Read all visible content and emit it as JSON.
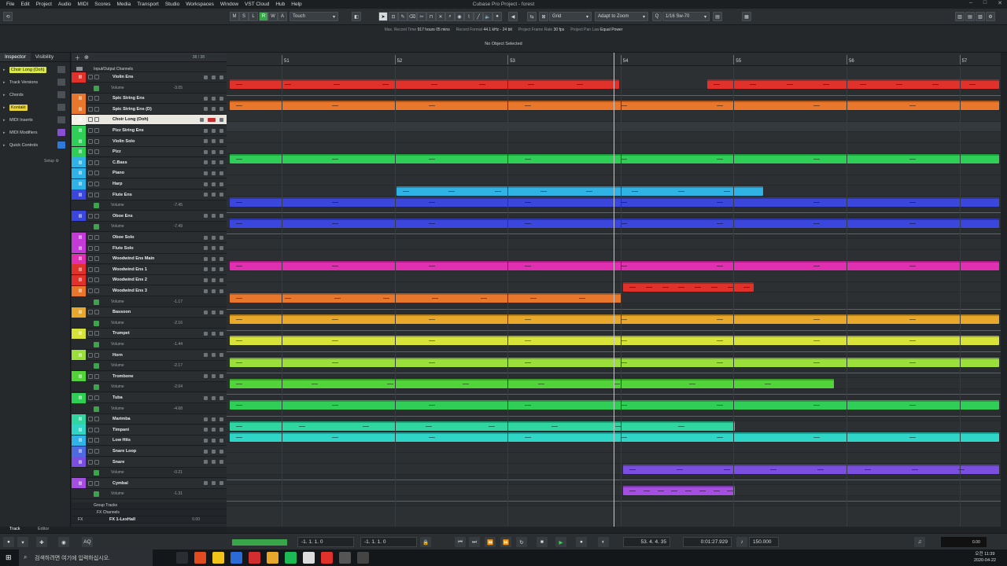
{
  "window": {
    "title": "Cubase Pro Project - forest",
    "menu": [
      "File",
      "Edit",
      "Project",
      "Audio",
      "MIDI",
      "Scores",
      "Media",
      "Transport",
      "Studio",
      "Workspaces",
      "Window",
      "VST Cloud",
      "Hub",
      "Help"
    ]
  },
  "toolbar": {
    "msra": [
      "M",
      "S",
      "L",
      "R",
      "W",
      "A"
    ],
    "automation_mode": "Touch",
    "snap_type": "Grid",
    "grid_label": "Adapt to Zoom",
    "quantize": "1/16 Sw-70"
  },
  "infoline": [
    {
      "label": "Max. Record Time",
      "value": "917 hours 05 mins"
    },
    {
      "label": "Record Format",
      "value": "44.1 kHz - 24 bit"
    },
    {
      "label": "Project Frame Rate",
      "value": "30 fps"
    },
    {
      "label": "Project Pan Law",
      "value": "Equal Power"
    }
  ],
  "eventline": "No Object Selected",
  "inspector": {
    "tabs": [
      "Inspector",
      "Visibility"
    ],
    "sections": [
      {
        "label": "Choir Long (Ooh)",
        "style": "pill"
      },
      {
        "label": "Track Versions"
      },
      {
        "label": "Chords"
      },
      {
        "label": "Kontakt",
        "style": "pill-orange"
      },
      {
        "label": "MIDI Inserts"
      },
      {
        "label": "MIDI Modifiers"
      },
      {
        "label": "Quick Controls"
      }
    ],
    "setup": "Setup"
  },
  "tracklist": {
    "count": "38 / 38",
    "folder": "Input/Output Channels",
    "group_tracks": "Group Tracks",
    "fx_channels": "FX Channels",
    "fx1": "FX 1-LexHall",
    "fx1_val": "0.00"
  },
  "tracks": [
    {
      "name": "Violin Ens",
      "color": "#e0312a",
      "auto": "-3.05"
    },
    {
      "name": "Spic String Ens",
      "color": "#e8772b"
    },
    {
      "name": "Spic String Ens (D)",
      "color": "#e8772b"
    },
    {
      "name": "Choir Long (Ooh)",
      "color": "#f3f1e8",
      "selected": true
    },
    {
      "name": "Pizz String Ens",
      "color": "#2fcf57"
    },
    {
      "name": "Violin Solo",
      "color": "#2fcf57"
    },
    {
      "name": "Pizz",
      "color": "#2fcf57"
    },
    {
      "name": "C.Bass",
      "color": "#2fb3e6"
    },
    {
      "name": "Piano",
      "color": "#2fb3e6"
    },
    {
      "name": "Harp",
      "color": "#2fb3e6"
    },
    {
      "name": "Flute Ens",
      "color": "#3b47dc",
      "auto": "-7.45"
    },
    {
      "name": "Oboe Ens",
      "color": "#3b47dc",
      "auto": "-7.49"
    },
    {
      "name": "Oboe Solo",
      "color": "#c43ad6"
    },
    {
      "name": "Flute Solo",
      "color": "#c43ad6"
    },
    {
      "name": "Woodwind Ens Main",
      "color": "#e02fb0"
    },
    {
      "name": "Woodwind Ens 1",
      "color": "#e0312a"
    },
    {
      "name": "Woodwind Ens 2",
      "color": "#e0312a"
    },
    {
      "name": "Woodwind Ens 3",
      "color": "#e8772b",
      "auto": "-1.17"
    },
    {
      "name": "Bassoon",
      "color": "#e8a82b",
      "auto": "-2.16"
    },
    {
      "name": "Trumpet",
      "color": "#d8e33a",
      "auto": "-1.44"
    },
    {
      "name": "Horn",
      "color": "#9be03a",
      "auto": "-2.17"
    },
    {
      "name": "Trombone",
      "color": "#52d33a",
      "auto": "-2.04"
    },
    {
      "name": "Tuba",
      "color": "#2fcf57",
      "auto": "-4.68"
    },
    {
      "name": "Marimba",
      "color": "#2fd6a0"
    },
    {
      "name": "Timpani",
      "color": "#2fd6c8"
    },
    {
      "name": "Low Hits",
      "color": "#2fb3e6"
    },
    {
      "name": "Snare Loop",
      "color": "#4f6ae0"
    },
    {
      "name": "Snare",
      "color": "#7a4fe0",
      "auto": "-0.21"
    },
    {
      "name": "Cymbal",
      "color": "#a54fe0",
      "auto": "-1.31"
    }
  ],
  "automation_label": "Volume",
  "ruler": [
    "51",
    "52",
    "53",
    "54",
    "55",
    "56",
    "57"
  ],
  "bottom_tabs": [
    "Track",
    "Editor"
  ],
  "transport": {
    "left_locator": "-1. 1. 1.   0",
    "right_locator": "-1. 1. 1.   0",
    "position_bars": "53. 4. 4. 35",
    "position_time": "0:01:27.929",
    "tempo": "150.000",
    "tempo_small": "0.00"
  },
  "taskbar": {
    "search_placeholder": "검색하려면 여기에 입력하십시오.",
    "time": "오전 11:39",
    "date": "2020-04-22"
  }
}
